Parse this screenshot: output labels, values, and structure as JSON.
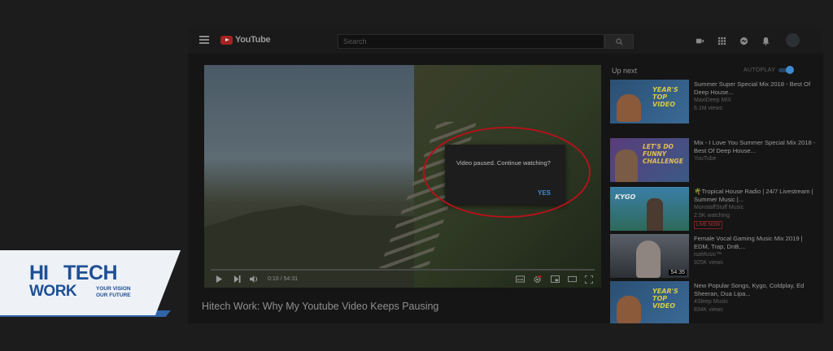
{
  "header": {
    "logo_text": "YouTube",
    "search_placeholder": "Search"
  },
  "player": {
    "pause_message": "Video paused. Continue watching?",
    "pause_yes": "YES",
    "time": "0:10 / 54:31",
    "progress_fraction": 0.003
  },
  "video": {
    "title": "Hitech Work: Why My Youtube Video Keeps Pausing"
  },
  "sidebar": {
    "up_next": "Up next",
    "autoplay": "AUTOPLAY",
    "autoplay_on": true,
    "items": [
      {
        "title": "Summer Super Special Mix 2018 - Best Of Deep House...",
        "channel": "MaxiDeep MIX",
        "meta": "6.1M views",
        "thumb_text": "YEAR'S TOP VIDEO"
      },
      {
        "title": "Mix - I Love You Summer Special Mix 2018 - Best Of Deep House...",
        "channel": "YouTube",
        "meta": "",
        "thumb_text": "LET'S DO FUNNY CHALLENGE"
      },
      {
        "title": "🌴Tropical House Radio | 24/7 Livestream | Summer Music |...",
        "channel": "MonstaffStuff Music",
        "meta": "2.5K watching",
        "badge": "LIVE NOW",
        "thumb_text": "KYGO"
      },
      {
        "title": "Female Vocal Gaming Music Mix 2019 | EDM, Trap, DnB,...",
        "channel": "isaMusic™",
        "meta": "925K views",
        "duration": "54:35",
        "thumb_text": ""
      },
      {
        "title": "New Popular Songs, Kygo, Coldplay, Ed Sheeran, Dua Lipa...",
        "channel": "4Sleep Music",
        "meta": "834K views",
        "thumb_text": "YEAR'S TOP VIDEO"
      }
    ]
  },
  "brand": {
    "hi": "HI",
    "tech": "TECH",
    "work": "WORK",
    "tagline_1": "YOUR VISION",
    "tagline_2": "OUR FUTURE"
  },
  "colors": {
    "accent_blue": "#3e8ad0",
    "youtube_red": "#a3231f",
    "annotation_red": "#b3121b",
    "brand_blue": "#1d4f95"
  }
}
